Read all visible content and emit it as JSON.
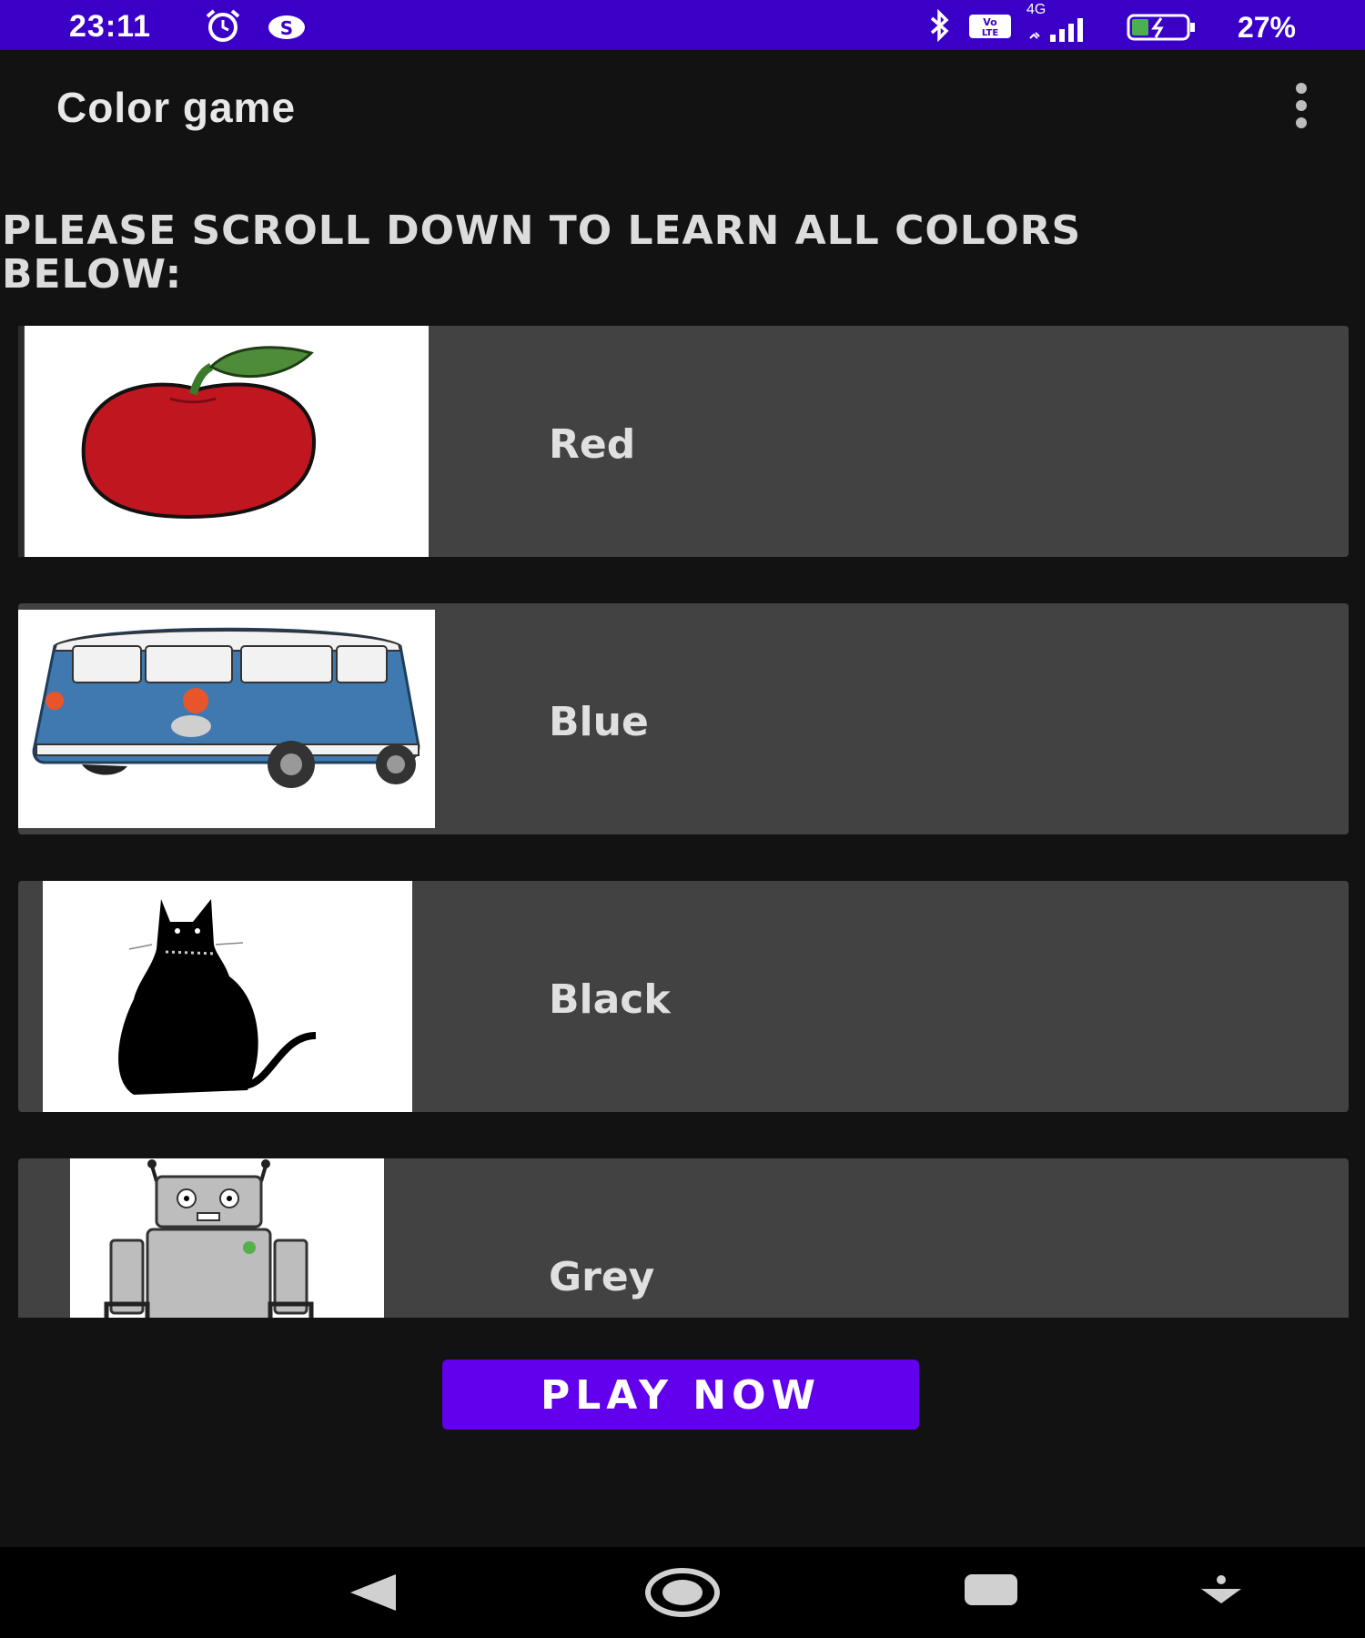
{
  "status_bar": {
    "time": "23:11",
    "network": "4G",
    "volte": "Vo LTE",
    "battery": "27%"
  },
  "app_bar": {
    "title": "Color game"
  },
  "instruction": "PLEASE SCROLL DOWN TO LEARN ALL COLORS BELOW:",
  "colors": [
    {
      "label": "Red",
      "icon": "apple-image",
      "accent": "#c0161f"
    },
    {
      "label": "Blue",
      "icon": "bus-image",
      "accent": "#3f79b0"
    },
    {
      "label": "Black",
      "icon": "cat-image",
      "accent": "#000000"
    },
    {
      "label": "Grey",
      "icon": "robot-image",
      "accent": "#b8b8b8"
    }
  ],
  "play_button": "PLAY NOW",
  "theme": {
    "status_bar": "#3a00c8",
    "accent": "#6200ee",
    "background": "#121212",
    "card": "#424242"
  }
}
